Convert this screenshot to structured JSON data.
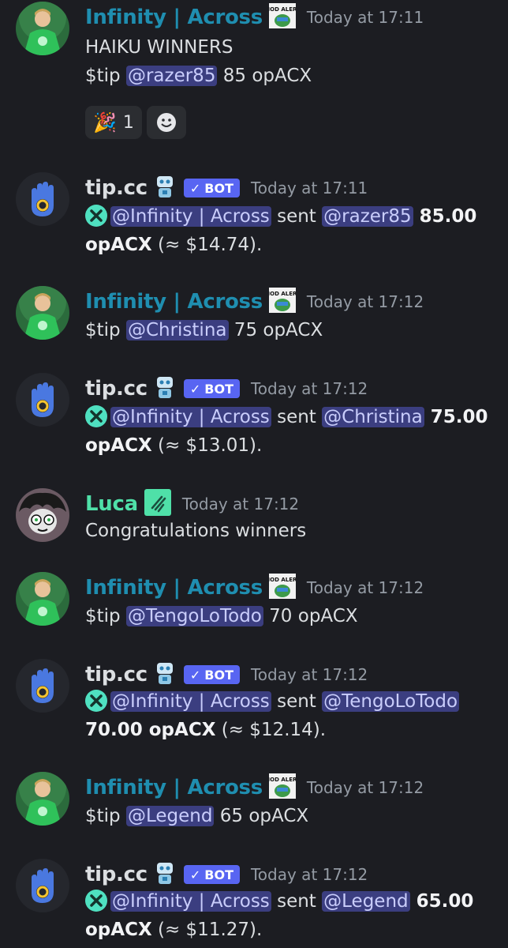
{
  "messages": [
    {
      "username": "Infinity | Across",
      "time": "Today at 17:11",
      "lines": [
        "HAIKU WINNERS"
      ],
      "tip": {
        "prefix": "$tip ",
        "mention": "@razer85",
        "suffix": " 85 opACX"
      },
      "reactions": [
        {
          "emoji_name": "party-popper-icon",
          "count": "1"
        },
        {
          "emoji_name": "add-reaction-icon"
        }
      ]
    },
    {
      "username": "tip.cc",
      "bot_label": "BOT",
      "time": "Today at 17:11",
      "sender": "@Infinity | Across",
      "sent_word": " sent ",
      "recipient": "@razer85",
      "amount_line1": " 85.00",
      "amount_line2": "opACX",
      "usd": " (≈ $14.74)."
    },
    {
      "username": "Infinity | Across",
      "time": "Today at 17:12",
      "tip": {
        "prefix": "$tip ",
        "mention": "@Christina",
        "suffix": " 75 opACX"
      }
    },
    {
      "username": "tip.cc",
      "bot_label": "BOT",
      "time": "Today at 17:12",
      "sender": "@Infinity | Across",
      "sent_word": " sent ",
      "recipient": "@Christina",
      "amount_line1": " 75.00",
      "amount_line2": "opACX",
      "usd": " (≈ $13.01)."
    },
    {
      "username": "Luca",
      "time": "Today at 17:12",
      "text": "Congratulations winners"
    },
    {
      "username": "Infinity | Across",
      "time": "Today at 17:12",
      "tip": {
        "prefix": "$tip ",
        "mention": "@TengoLoTodo",
        "suffix": " 70 opACX"
      }
    },
    {
      "username": "tip.cc",
      "bot_label": "BOT",
      "time": "Today at 17:12",
      "sender": "@Infinity | Across",
      "sent_word": " sent ",
      "recipient": "@TengoLoTodo",
      "amount_line1": "",
      "amount_line2": "70.00 opACX",
      "usd": " (≈ $12.14)."
    },
    {
      "username": "Infinity | Across",
      "time": "Today at 17:12",
      "tip": {
        "prefix": "$tip ",
        "mention": "@Legend",
        "suffix": " 65 opACX"
      }
    },
    {
      "username": "tip.cc",
      "bot_label": "BOT",
      "time": "Today at 17:12",
      "sender": "@Infinity | Across",
      "sent_word": " sent ",
      "recipient": "@Legend",
      "amount_line1": " 65.00",
      "amount_line2": "opACX",
      "usd": " (≈ $11.27)."
    }
  ],
  "badges": {
    "mod_alert_text": "MOD ALERT"
  },
  "colors": {
    "background": "#1c1d22",
    "infinity_name": "#1f8eb0",
    "luca_name": "#4fe0a8",
    "bot_badge": "#5865f2",
    "mention_bg": "#3b3e80",
    "tip_icon": "#4fe0c0"
  }
}
